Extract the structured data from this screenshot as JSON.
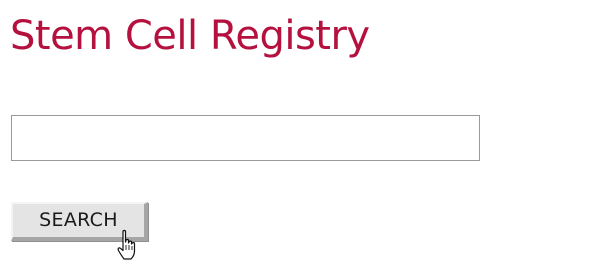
{
  "header": {
    "title": "Stem Cell Registry",
    "title_color": "#b5113f"
  },
  "search": {
    "value": "",
    "placeholder": "",
    "button_label": "SEARCH"
  },
  "cursor": {
    "icon": "hand-pointer-icon"
  }
}
